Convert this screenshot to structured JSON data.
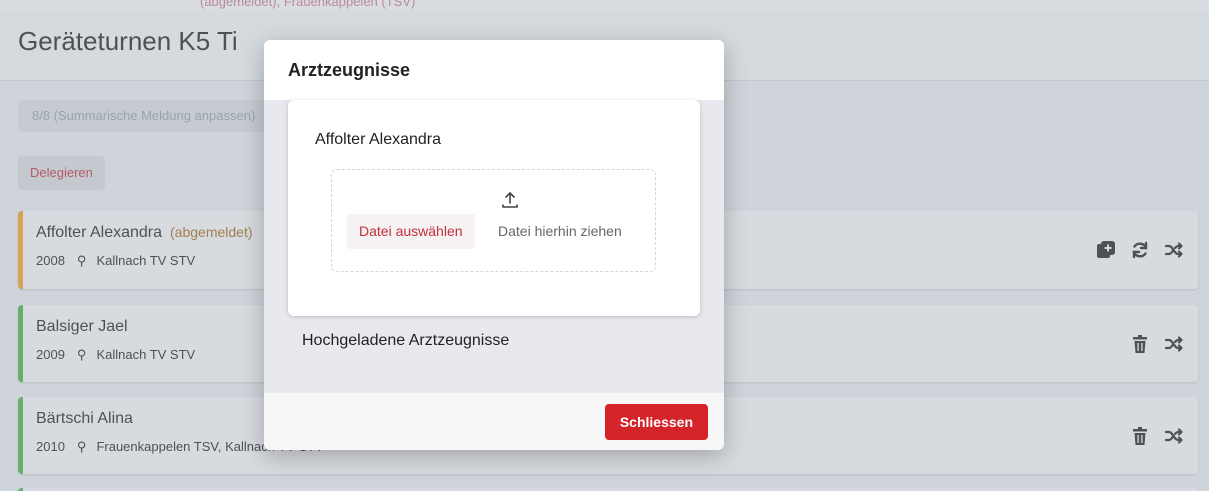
{
  "header": {
    "top_text": "(abgemeldet), Frauenkappelen (TSV)",
    "title": "Geräteturnen K5 Ti"
  },
  "summary": {
    "placeholder": "8/8 (Summarische Meldung anpassen)"
  },
  "delegate_label": "Delegieren",
  "colors": {
    "accent": "#d5232a",
    "bar_withdrawn": "#f0a020",
    "bar_ok": "#44b444"
  },
  "athletes": [
    {
      "name": "Affolter Alexandra",
      "status": "(abgemeldet)",
      "year": "2008",
      "club": "Kallnach TV STV",
      "icons": [
        "add-document-icon",
        "sync-icon",
        "shuffle-icon"
      ]
    },
    {
      "name": "Balsiger Jael",
      "status": "",
      "year": "2009",
      "club": "Kallnach TV STV",
      "icons": [
        "trash-icon",
        "shuffle-icon"
      ]
    },
    {
      "name": "Bärtschi Alina",
      "status": "",
      "year": "2010",
      "club": "Frauenkappelen TSV, Kallnach TV STV",
      "icons": [
        "trash-icon",
        "shuffle-icon"
      ]
    }
  ],
  "modal": {
    "title": "Arztzeugnisse",
    "athlete_name": "Affolter Alexandra",
    "choose_file": "Datei auswählen",
    "drop_hint": "Datei hierhin ziehen",
    "uploaded_heading": "Hochgeladene Arztzeugnisse",
    "close_label": "Schliessen"
  }
}
